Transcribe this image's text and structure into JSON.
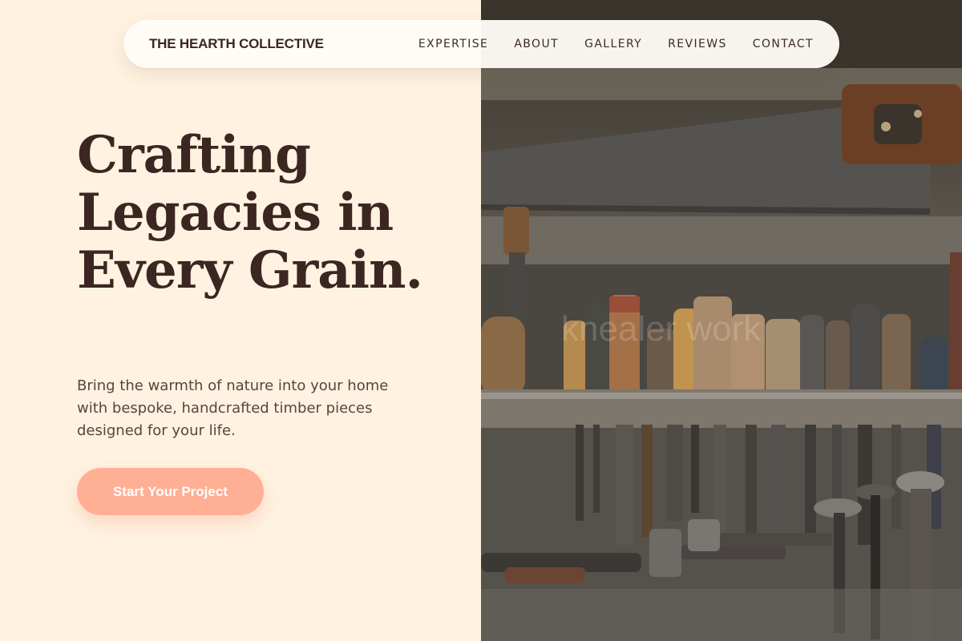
{
  "nav": {
    "brand": "THE HEARTH COLLECTIVE",
    "links": [
      {
        "label": "EXPERTISE"
      },
      {
        "label": "ABOUT"
      },
      {
        "label": "GALLERY"
      },
      {
        "label": "REVIEWS"
      },
      {
        "label": "CONTACT"
      }
    ]
  },
  "hero": {
    "title": "Crafting Legacies in Every Grain.",
    "subtitle": "Bring the warmth of nature into your home with bespoke, handcrafted timber pieces designed for your life.",
    "cta_label": "Start Your Project",
    "image_watermark": "knealer work"
  },
  "colors": {
    "background": "#FFF2E0",
    "text_dark": "#3B2622",
    "text_body": "#5A4340",
    "accent": "#FFAF94"
  }
}
